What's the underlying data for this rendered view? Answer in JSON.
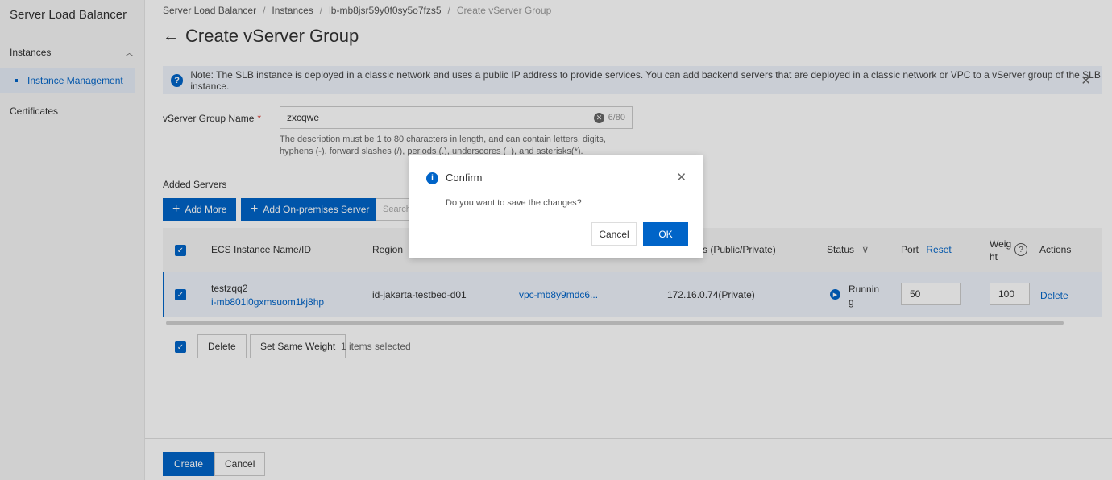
{
  "sidebar": {
    "title": "Server Load Balancer",
    "group_label": "Instances",
    "active_item": "Instance Management",
    "item_certificates": "Certificates"
  },
  "breadcrumb": {
    "items": [
      "Server Load Balancer",
      "Instances",
      "lb-mb8jsr59y0f0sy5o7fzs5"
    ],
    "current": "Create vServer Group"
  },
  "page": {
    "title": "Create vServer Group"
  },
  "notice": {
    "text": "Note: The SLB instance is deployed in a classic network and uses a public IP address to provide services. You can add backend servers that are deployed in a classic network or VPC to a vServer group of the SLB instance."
  },
  "form": {
    "name_label": "vServer Group Name",
    "required_mark": "*",
    "name_value": "zxcqwe",
    "name_count": "6/80",
    "help": "The description must be 1 to 80 characters in length, and can contain letters, digits, hyphens (-), forward slashes (/), periods (.), underscores (_), and asterisks(*)."
  },
  "servers": {
    "section_label": "Added Servers",
    "add_more": "Add More",
    "add_onprem": "Add On-premises Server",
    "search_placeholder": "Search",
    "columns": {
      "name": "ECS Instance Name/ID",
      "region": "Region",
      "address": "ss (Public/Private)",
      "status": "Status",
      "port": "Port",
      "reset": "Reset",
      "weight": "Weig\nht",
      "actions": "Actions"
    },
    "row": {
      "name": "testzqq2",
      "id": "i-mb801i0gxmsuom1kj8hp",
      "region": "id-jakarta-testbed-d01",
      "vpc": "vpc-mb8y9mdc6...",
      "address": "172.16.0.74(Private)",
      "status": "Running",
      "port": "50",
      "weight": "100",
      "delete": "Delete"
    },
    "bulk_delete": "Delete",
    "bulk_weight": "Set Same Weight",
    "selected_count": "1 items selected"
  },
  "footer": {
    "create": "Create",
    "cancel": "Cancel"
  },
  "dialog": {
    "title": "Confirm",
    "message": "Do you want to save the changes?",
    "cancel": "Cancel",
    "ok": "OK"
  },
  "colors": {
    "primary": "#0064c8",
    "required": "#d93026"
  }
}
